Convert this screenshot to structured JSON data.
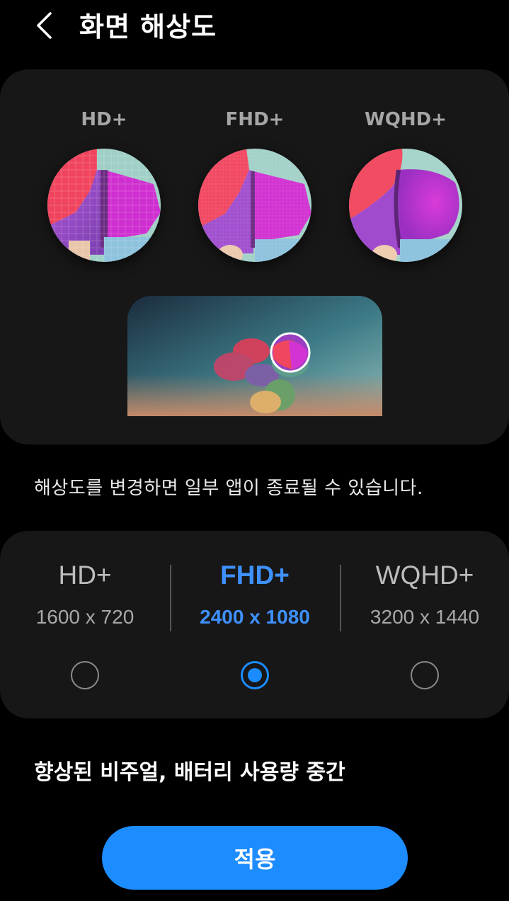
{
  "header": {
    "back_icon": "chevron-left-icon",
    "title": "화면 해상도"
  },
  "preview": {
    "labels": [
      "HD+",
      "FHD+",
      "WQHD+"
    ],
    "magnifier_icon": "magnifier-circle"
  },
  "warning_text": "해상도를 변경하면 일부 앱이 종료될 수 있습니다.",
  "options": [
    {
      "name": "HD+",
      "resolution": "1600 x 720",
      "selected": false
    },
    {
      "name": "FHD+",
      "resolution": "2400 x 1080",
      "selected": true
    },
    {
      "name": "WQHD+",
      "resolution": "3200 x 1440",
      "selected": false
    }
  ],
  "description": "향상된 비주얼, 배터리 사용량 중간",
  "apply_label": "적용",
  "colors": {
    "background": "#000000",
    "card": "#171717",
    "accent": "#1d8cff",
    "selected_text": "#3e91ff"
  }
}
